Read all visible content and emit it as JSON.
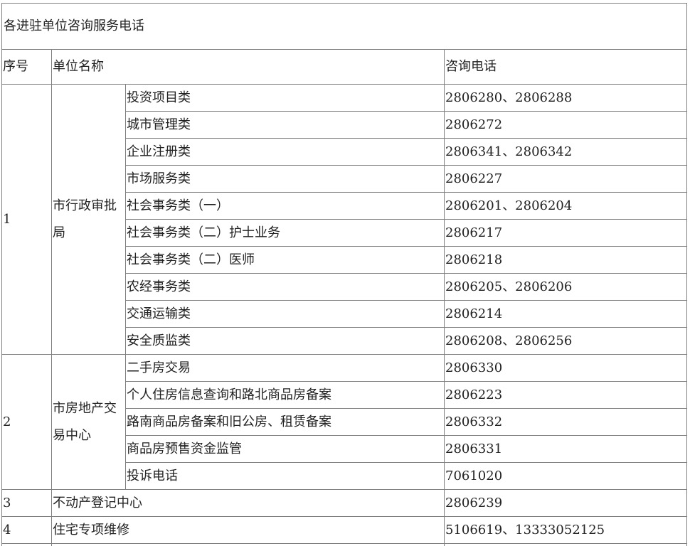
{
  "title": "各进驻单位咨询服务电话",
  "headers": {
    "seq": "序号",
    "unit": "单位名称",
    "phone": "咨询电话"
  },
  "groups": [
    {
      "seq": "1",
      "unit": "市行政审批局",
      "items": [
        {
          "category": "投资项目类",
          "phone": "2806280、2806288"
        },
        {
          "category": "城市管理类",
          "phone": "2806272"
        },
        {
          "category": "企业注册类",
          "phone": "2806341、2806342"
        },
        {
          "category": "市场服务类",
          "phone": "2806227"
        },
        {
          "category": "社会事务类（一）",
          "phone": "2806201、2806204"
        },
        {
          "category": "社会事务类（二）护士业务",
          "phone": "2806217"
        },
        {
          "category": "社会事务类（二）医师",
          "phone": "2806218"
        },
        {
          "category": "农经事务类",
          "phone": "2806205、2806206"
        },
        {
          "category": "交通运输类",
          "phone": "2806214"
        },
        {
          "category": "安全质监类",
          "phone": "2806208、2806256"
        }
      ]
    },
    {
      "seq": "2",
      "unit": "市房地产交易中心",
      "items": [
        {
          "category": "二手房交易",
          "phone": "2806330"
        },
        {
          "category": "个人住房信息查询和路北商品房备案",
          "phone": "2806223"
        },
        {
          "category": "路南商品房备案和旧公房、租赁备案",
          "phone": "2806332"
        },
        {
          "category": "商品房预售资金监管",
          "phone": "2806331"
        },
        {
          "category": "投诉电话",
          "phone": "7061020"
        }
      ]
    }
  ],
  "singles": [
    {
      "seq": "3",
      "unit": "不动产登记中心",
      "phone": "2806239"
    },
    {
      "seq": "4",
      "unit": "住宅专项维修",
      "phone": "5106619、13333052125"
    }
  ]
}
